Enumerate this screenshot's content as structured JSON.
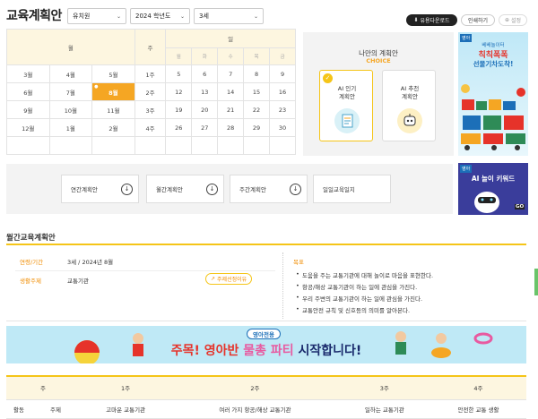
{
  "header": {
    "title": "교육계획안",
    "filters": [
      "유치원",
      "2024 학년도",
      "3세"
    ],
    "download_label": "유용다운로드",
    "print_label": "인쇄하기",
    "settings_label": "설정"
  },
  "calendar": {
    "month_header": "월",
    "week_header": "주",
    "day_header": "일",
    "day_names": [
      "월",
      "화",
      "수",
      "목",
      "금"
    ],
    "rows": [
      {
        "months": [
          "3월",
          "4월",
          "5월"
        ],
        "week": "1주",
        "days": [
          "5",
          "6",
          "7",
          "8",
          "9"
        ]
      },
      {
        "months": [
          "6월",
          "7월",
          "8월"
        ],
        "week": "2주",
        "days": [
          "12",
          "13",
          "14",
          "15",
          "16"
        ]
      },
      {
        "months": [
          "9월",
          "10월",
          "11월"
        ],
        "week": "3주",
        "days": [
          "19",
          "20",
          "21",
          "22",
          "23"
        ]
      },
      {
        "months": [
          "12월",
          "1월",
          "2월"
        ],
        "week": "4주",
        "days": [
          "26",
          "27",
          "28",
          "29",
          "30"
        ]
      }
    ],
    "selected_month": "8월"
  },
  "choice": {
    "title": "나만의 계획안",
    "subtitle": "CHOICE",
    "cards": [
      {
        "label_1": "AI 인기",
        "label_2": "계획안"
      },
      {
        "label_1": "AI 추천",
        "label_2": "계획안"
      }
    ]
  },
  "ads": {
    "ad1_tag": "영아",
    "ad1_line1": "베베놀이터",
    "ad1_line2": "칙칙폭폭",
    "ad1_line3": "선물기차도착!",
    "ad2_tag": "영아",
    "ad2_title": "AI 놀이 키워드",
    "ad2_go": "GO"
  },
  "quicknav": [
    "연간계획안",
    "월간계획안",
    "주간계획안",
    "일일교육일지"
  ],
  "monthly": {
    "heading": "월간교육계획안",
    "info": [
      {
        "label": "연령/기간",
        "value": "3세 / 2024년 8월"
      },
      {
        "label": "생활주제",
        "value": "교통기관"
      }
    ],
    "theme_link": "주제선정이유",
    "goal_label": "목표",
    "goals": [
      "도움을 주는 교통기관에 대해 놀이로 마음을 표현한다.",
      "항공/해상 교통기관이 하는 일에 관심을 가진다.",
      "우리 주변의 교통기관이 하는 일에 관심을 가진다.",
      "교통안전 규칙 및 신호등의 의미를 알아본다."
    ]
  },
  "banner": {
    "tag": "영아전용",
    "headline_pre": "주목! 영아반 ",
    "headline_hl": "물총 파티",
    "headline_post": " 시작합니다!"
  },
  "weekly": {
    "headers": [
      "주",
      "1주",
      "2주",
      "3주",
      "4주"
    ],
    "row_label_1": "활동",
    "row_label_2": "주제",
    "topics": [
      "고마운 교통기관",
      "여러 가지 항공/해상 교통기관",
      "일하는 교통기관",
      "안전한 교통 생활"
    ]
  },
  "colors": {
    "accent": "#f5c518",
    "orange": "#f5a623",
    "label": "#f08c00",
    "header_bg": "#fdf6e0"
  }
}
